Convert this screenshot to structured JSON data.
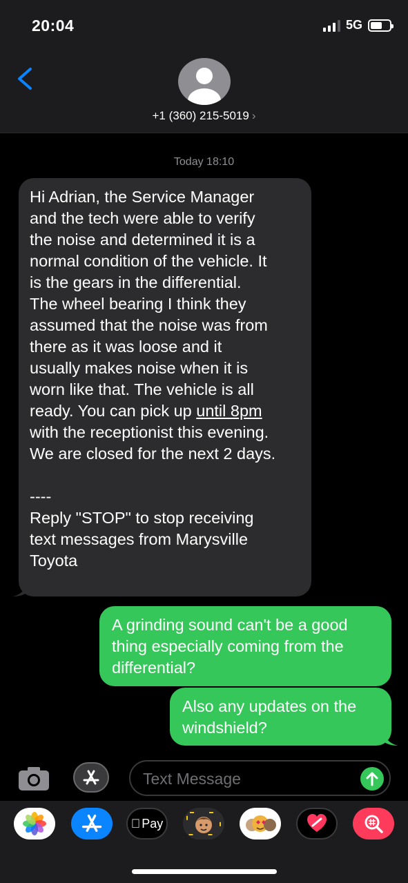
{
  "status_bar": {
    "time": "20:04",
    "network": "5G"
  },
  "header": {
    "contact": "+1 (360) 215-5019",
    "chevron": "›"
  },
  "thread": {
    "timestamp": "Today 18:10",
    "incoming": {
      "text_before_link": "Hi Adrian, the Service Manager\nand the tech were able to verify\nthe noise and determined it is a\nnormal condition of the vehicle. It\nis the gears in the differential.\nThe wheel bearing I think they\nassumed that the noise was from\nthere as it was loose and it\nusually makes noise when it is\nworn like that. The vehicle is all\nready. You can pick up ",
      "link_text": "until 8pm",
      "text_after_link": "\nwith the receptionist this evening.\nWe are closed for the next 2 days.\n\n----\nReply \"STOP\" to stop receiving\ntext messages from Marysville\nToyota"
    },
    "outgoing": [
      "A grinding sound can't be a good\nthing especially coming from the\ndifferential?",
      "Also any updates on the\nwindshield?"
    ]
  },
  "composer": {
    "placeholder": "Text Message"
  },
  "app_drawer": {
    "apps": [
      "photos-icon",
      "app-store-icon",
      "apple-pay-icon",
      "memoji-icon",
      "animoji-icon",
      "digital-touch-icon",
      "image-search-icon"
    ],
    "apple_pay_label": "Pay"
  },
  "colors": {
    "incoming": "#2c2c2e",
    "outgoing": "#35c759",
    "accent": "#0a84ff"
  }
}
